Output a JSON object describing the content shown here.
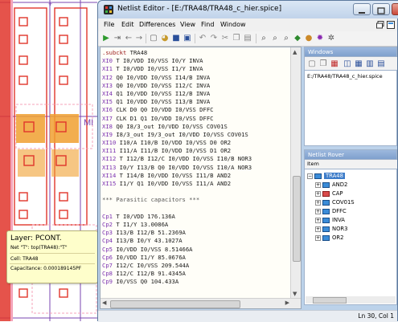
{
  "window": {
    "title": "Netlist Editor - [E:/TRA48/TRA48_c_hier.spice]",
    "menus": [
      "File",
      "Edit",
      "Differences",
      "View",
      "Find",
      "Window"
    ]
  },
  "editor": {
    "lines": [
      [
        [
          "kw",
          ".subckt"
        ],
        [
          "",
          "TRA48"
        ]
      ],
      [
        [
          "id",
          "XI0"
        ],
        [
          "",
          "T I0/VDD I0/VSS I0/Y INVA"
        ]
      ],
      [
        [
          "id",
          "XI1"
        ],
        [
          "",
          "T I0/VDD I0/VSS I1/Y INVA"
        ]
      ],
      [
        [
          "id",
          "XI2"
        ],
        [
          "",
          "Q0 I0/VDD I0/VSS I14/B INVA"
        ]
      ],
      [
        [
          "id",
          "XI3"
        ],
        [
          "",
          "Q0 I0/VDD I0/VSS I12/C INVA"
        ]
      ],
      [
        [
          "id",
          "XI4"
        ],
        [
          "",
          "Q1 I0/VDD I0/VSS I12/B INVA"
        ]
      ],
      [
        [
          "id",
          "XI5"
        ],
        [
          "",
          "Q1 I0/VDD I0/VSS I13/B INVA"
        ]
      ],
      [
        [
          "id",
          "XI6"
        ],
        [
          "",
          "CLK D0 Q0 I0/VDD I0/VSS DFFC"
        ]
      ],
      [
        [
          "id",
          "XI7"
        ],
        [
          "",
          "CLK D1 Q1 I0/VDD I0/VSS DFFC"
        ]
      ],
      [
        [
          "id",
          "XI8"
        ],
        [
          "",
          "Q0 I8/3_out I0/VDD I0/VSS COV01S"
        ]
      ],
      [
        [
          "id",
          "XI9"
        ],
        [
          "",
          "I8/3_out I9/3_out I0/VDD I0/VSS COV01S"
        ]
      ],
      [
        [
          "id",
          "XI10"
        ],
        [
          "",
          "I10/A I10/B I0/VDD I0/VSS D0 OR2"
        ]
      ],
      [
        [
          "id",
          "XI11"
        ],
        [
          "",
          "I11/A I11/B I0/VDD I0/VSS D1 OR2"
        ]
      ],
      [
        [
          "id",
          "XI12"
        ],
        [
          "",
          "T I12/B I12/C I0/VDD I0/VSS I10/B NOR3"
        ]
      ],
      [
        [
          "id",
          "XI13"
        ],
        [
          "",
          "I0/Y I13/B Q0 I0/VDD I0/VSS I10/A NOR3"
        ]
      ],
      [
        [
          "id",
          "XI14"
        ],
        [
          "",
          "T I14/B I0/VDD I0/VSS I11/B AND2"
        ]
      ],
      [
        [
          "id",
          "XI15"
        ],
        [
          "",
          "I1/Y Q1 I0/VDD I0/VSS I11/A AND2"
        ]
      ],
      [
        [
          "",
          ""
        ]
      ],
      [
        [
          "cm",
          "*** Parasitic capacitors ***"
        ]
      ],
      [
        [
          "",
          ""
        ]
      ],
      [
        [
          "id",
          "Cp1"
        ],
        [
          "",
          "T I0/VDD 176.136A"
        ]
      ],
      [
        [
          "id",
          "Cp2"
        ],
        [
          "",
          "T I1/Y 13.0086A"
        ]
      ],
      [
        [
          "id",
          "Cp3"
        ],
        [
          "",
          "I13/B I12/B 51.2369A"
        ]
      ],
      [
        [
          "id",
          "Cp4"
        ],
        [
          "",
          "I13/B I0/Y 43.1027A"
        ]
      ],
      [
        [
          "id",
          "Cp5"
        ],
        [
          "",
          "I0/VDD I0/VSS 8.51466A"
        ]
      ],
      [
        [
          "id",
          "Cp6"
        ],
        [
          "",
          "I0/VDD I1/Y 85.0676A"
        ]
      ],
      [
        [
          "id",
          "Cp7"
        ],
        [
          "",
          "I12/C I0/VSS 209.544A"
        ]
      ],
      [
        [
          "id",
          "Cp8"
        ],
        [
          "",
          "I12/C I12/B 91.4345A"
        ]
      ],
      [
        [
          "id",
          "Cp9"
        ],
        [
          "",
          "I0/VSS Q0 104.433A"
        ]
      ]
    ]
  },
  "windows_panel": {
    "title": "Windows",
    "entries": [
      "E:/TRA48/TRA48_c_hier.spice"
    ]
  },
  "netlist_rover": {
    "title": "Netlist Rover",
    "column": "Item",
    "root": "TRA48",
    "children": [
      {
        "label": "AND2",
        "color": "blue"
      },
      {
        "label": "CAP",
        "color": "red"
      },
      {
        "label": "COV01S",
        "color": "blue"
      },
      {
        "label": "DFFC",
        "color": "blue"
      },
      {
        "label": "INVA",
        "color": "blue"
      },
      {
        "label": "NOR3",
        "color": "blue"
      },
      {
        "label": "OR2",
        "color": "blue"
      }
    ]
  },
  "status": {
    "position": "Ln 30, Col 1"
  },
  "tooltip": {
    "layer": "Layer: PCONT.",
    "net": "Net \"T\": top(TRA48):\"T\"",
    "cell": "Cell: TRA48",
    "capacitance": "Capacitance: 0.000189145PF"
  },
  "layout": {
    "label": "MI"
  },
  "colors": {
    "layout_red": "#e0352b",
    "layout_pink": "#f4a3b8",
    "layout_orange": "#f0a030",
    "layout_purple": "#7a45b0",
    "tooltip_bg": "#fefecb",
    "tree_selected": "#3d7cc9"
  },
  "icons": {
    "app": "netlist-editor-icon",
    "tree_node": "cell-chip-icon",
    "tree_node_cap": "capacitor-chip-icon"
  }
}
